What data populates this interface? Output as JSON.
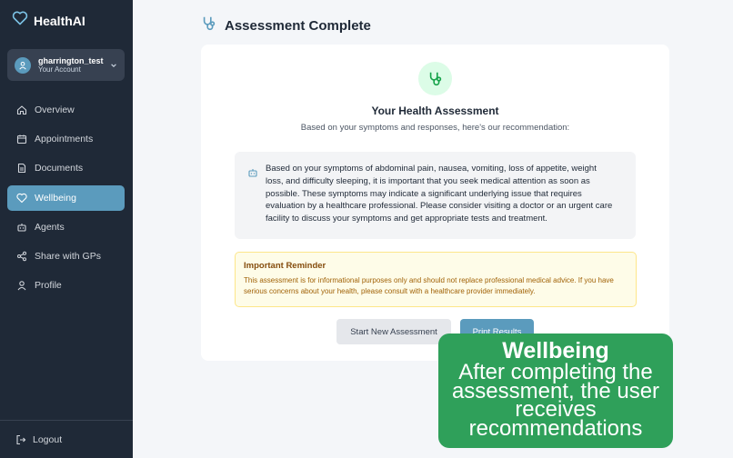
{
  "app": {
    "name": "HealthAI",
    "brand_color": "#5b9bbd"
  },
  "account": {
    "username": "gharrington_test",
    "subtitle": "Your Account"
  },
  "sidebar": {
    "items": [
      {
        "label": "Overview",
        "icon": "home-icon"
      },
      {
        "label": "Appointments",
        "icon": "calendar-icon"
      },
      {
        "label": "Documents",
        "icon": "document-icon"
      },
      {
        "label": "Wellbeing",
        "icon": "heart-icon",
        "active": true
      },
      {
        "label": "Agents",
        "icon": "robot-icon"
      },
      {
        "label": "Share with GPs",
        "icon": "share-icon"
      },
      {
        "label": "Profile",
        "icon": "user-icon"
      }
    ],
    "logout_label": "Logout"
  },
  "page": {
    "title": "Assessment Complete"
  },
  "assessment": {
    "title": "Your Health Assessment",
    "subtitle": "Based on your symptoms and responses, here's our recommendation:",
    "recommendation": "Based on your symptoms of abdominal pain, nausea, vomiting, loss of appetite, weight loss, and difficulty sleeping, it is important that you seek medical attention as soon as possible. These symptoms may indicate a significant underlying issue that requires evaluation by a healthcare professional. Please consider visiting a doctor or an urgent care facility to discuss your symptoms and get appropriate tests and treatment."
  },
  "reminder": {
    "title": "Important Reminder",
    "text": "This assessment is for informational purposes only and should not replace professional medical advice. If you have serious concerns about your health, please consult with a healthcare provider immediately."
  },
  "buttons": {
    "new_assessment": "Start New Assessment",
    "print": "Print Results"
  },
  "overlay": {
    "title": "Wellbeing",
    "text": "After completing the assessment, the user receives recommendations",
    "color": "#2fa05a"
  }
}
